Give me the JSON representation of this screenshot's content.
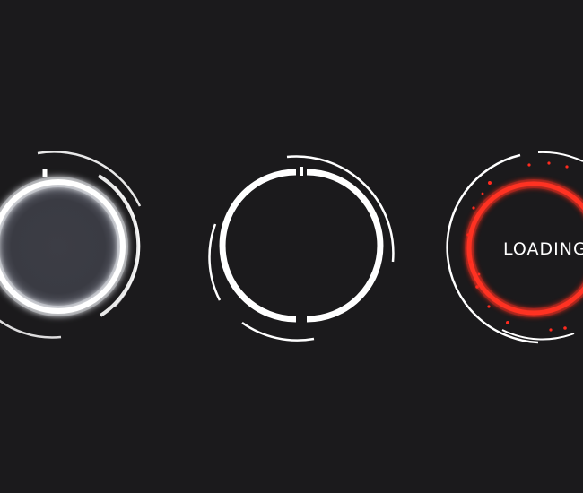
{
  "loaders": [
    {
      "name": "glow-ring",
      "style": "white-glow"
    },
    {
      "name": "split-ring",
      "style": "white-segmented"
    },
    {
      "name": "red-ring",
      "style": "red-particle",
      "label": "LOADING"
    }
  ],
  "colors": {
    "background": "#1b1a1c",
    "white": "#ffffff",
    "accent_red": "#ff2a1e",
    "dark_core": "#3a3b42"
  }
}
